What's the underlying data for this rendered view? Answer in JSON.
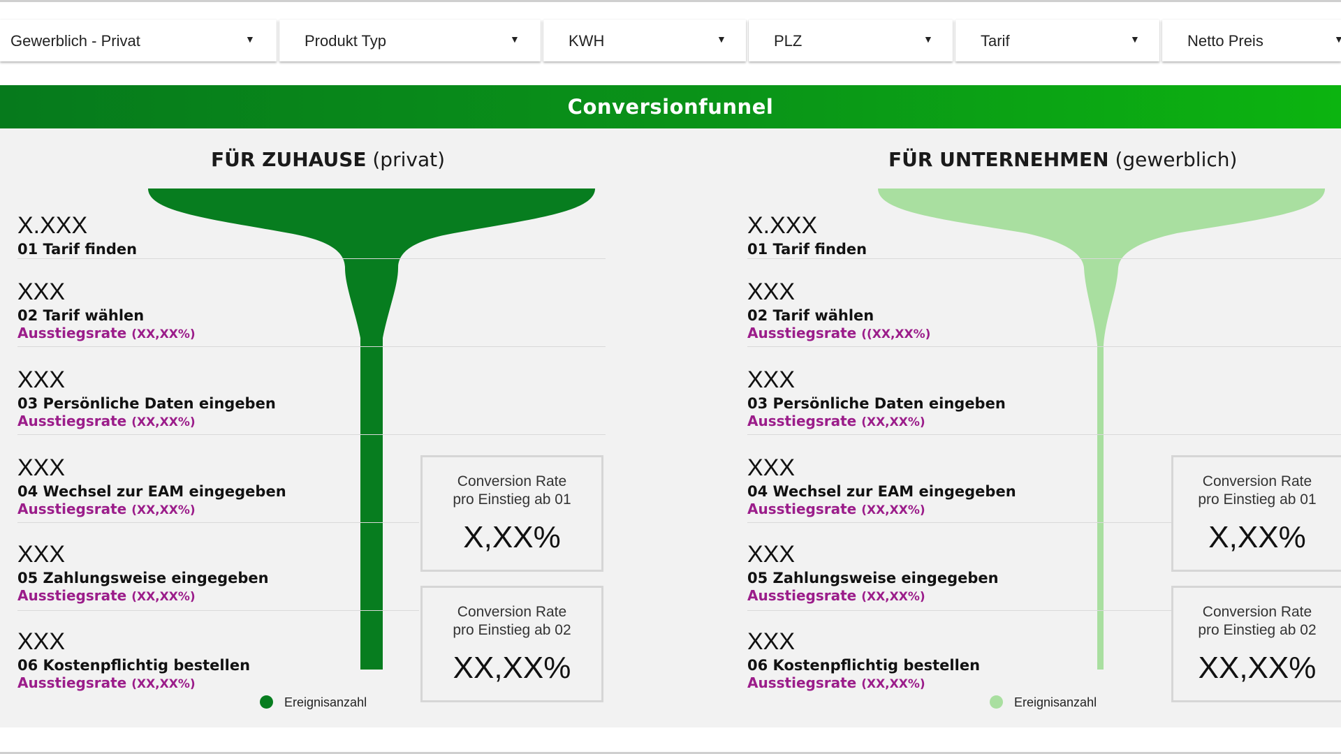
{
  "filters": [
    {
      "label": "Gewerblich - Privat"
    },
    {
      "label": "Produkt Typ"
    },
    {
      "label": "KWH"
    },
    {
      "label": "PLZ"
    },
    {
      "label": "Tarif"
    },
    {
      "label": "Netto Preis"
    }
  ],
  "banner": {
    "title": "Conversionfunnel"
  },
  "colors": {
    "private_funnel": "#077d1f",
    "business_funnel": "#a9dfa0",
    "exit_rate_text": "#9b1d8a",
    "banner_start": "#067a1c",
    "banner_end": "#0cb410"
  },
  "private": {
    "title_bold": "FÜR ZUHAUSE",
    "title_rest": " (privat)",
    "steps": [
      {
        "value": "X.XXX",
        "name": "01 Tarif finden",
        "exit_label": "",
        "exit_rate": ""
      },
      {
        "value": "XXX",
        "name": "02 Tarif wählen",
        "exit_label": "Ausstiegsrate",
        "exit_rate": "(XX,XX%)"
      },
      {
        "value": "XXX",
        "name": "03 Persönliche Daten eingeben",
        "exit_label": "Ausstiegsrate",
        "exit_rate": "(XX,XX%)"
      },
      {
        "value": "XXX",
        "name": "04 Wechsel zur EAM eingegeben",
        "exit_label": "Ausstiegsrate",
        "exit_rate": "(XX,XX%)"
      },
      {
        "value": "XXX",
        "name": "05 Zahlungsweise eingegeben",
        "exit_label": "Ausstiegsrate",
        "exit_rate": "(XX,XX%)"
      },
      {
        "value": "XXX",
        "name": "06 Kostenpflichtig bestellen",
        "exit_label": "Ausstiegsrate",
        "exit_rate": "(XX,XX%)"
      }
    ],
    "cr1": {
      "label1": "Conversion Rate",
      "label2": "pro Einstieg ab 01",
      "value": "X,XX%"
    },
    "cr2": {
      "label1": "Conversion Rate",
      "label2": "pro Einstieg ab 02",
      "value": "XX,XX%"
    },
    "legend": "Ereignisanzahl"
  },
  "business": {
    "title_bold": "FÜR UNTERNEHMEN",
    "title_rest": " (gewerblich)",
    "steps": [
      {
        "value": "X.XXX",
        "name": "01 Tarif finden",
        "exit_label": "",
        "exit_rate": ""
      },
      {
        "value": "XXX",
        "name": "02 Tarif wählen",
        "exit_label": "Ausstiegsrate",
        "exit_rate": "((XX,XX%)"
      },
      {
        "value": "XXX",
        "name": "03 Persönliche Daten eingeben",
        "exit_label": "Ausstiegsrate",
        "exit_rate": "(XX,XX%)"
      },
      {
        "value": "XXX",
        "name": "04 Wechsel zur EAM eingegeben",
        "exit_label": "Ausstiegsrate",
        "exit_rate": "(XX,XX%)"
      },
      {
        "value": "XXX",
        "name": "05 Zahlungsweise eingegeben",
        "exit_label": "Ausstiegsrate",
        "exit_rate": "(XX,XX%)"
      },
      {
        "value": "XXX",
        "name": "06 Kostenpflichtig bestellen",
        "exit_label": "Ausstiegsrate",
        "exit_rate": "(XX,XX%)"
      }
    ],
    "cr1": {
      "label1": "Conversion Rate",
      "label2": "pro Einstieg ab 01",
      "value": "X,XX%"
    },
    "cr2": {
      "label1": "Conversion Rate",
      "label2": "pro Einstieg ab 02",
      "value": "XX,XX%"
    },
    "legend": "Ereignisanzahl"
  }
}
